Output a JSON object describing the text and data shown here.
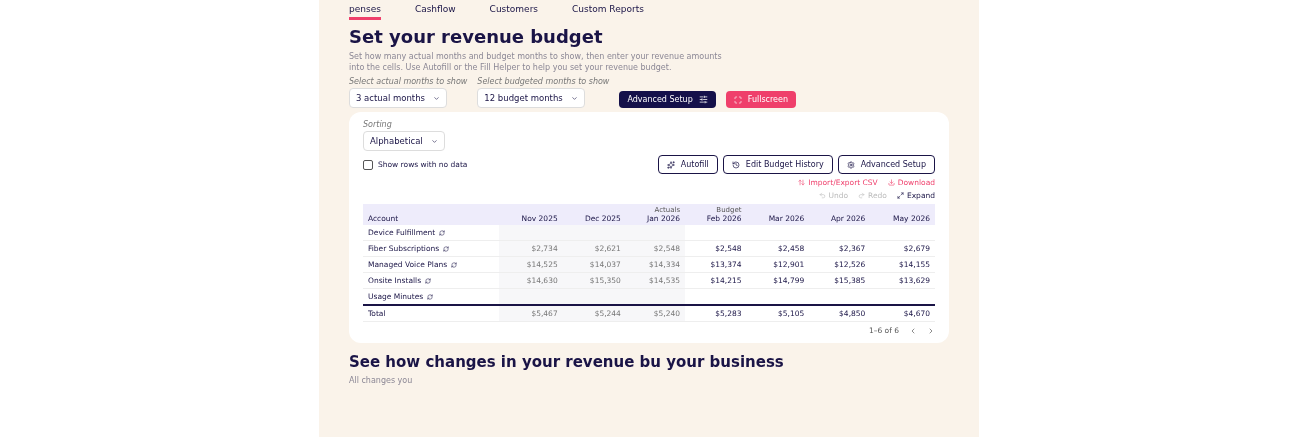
{
  "nav_tabs": [
    {
      "label": "penses",
      "selected": true
    },
    {
      "label": "Cashflow",
      "selected": false
    },
    {
      "label": "Customers",
      "selected": false
    },
    {
      "label": "Custom Reports",
      "selected": false
    }
  ],
  "title": "Set your revenue budget",
  "description": "Set how many actual months and budget months to show, then enter your revenue amounts into the cells. Use Autofill or the Fill Helper to help you set your revenue budget.",
  "selects": [
    {
      "label": "Select actual months to show",
      "value": "3 actual months"
    },
    {
      "label": "Select budgeted months to show",
      "value": "12 budget months"
    }
  ],
  "advanced_setup_button": "Advanced Setup",
  "fullscreen_button": "Fullscreen",
  "sorting": {
    "label": "Sorting",
    "value": "Alphabetical"
  },
  "show_empty_rows": {
    "label": "Show rows with no data",
    "checked": false
  },
  "actions": [
    "Autofill",
    "Edit Budget History",
    "Advanced Setup"
  ],
  "import_export": "Import/Export CSV",
  "download": "Download",
  "undo": "Undo",
  "redo": "Redo",
  "expand": "Expand",
  "table": {
    "account_header": "Account",
    "actuals_label": "Actuals",
    "budget_label": "Budget",
    "actual_columns": [
      "Nov 2025",
      "Dec 2025",
      "Jan 2026"
    ],
    "budget_columns": [
      "Feb 2026",
      "Mar 2026",
      "Apr 2026",
      "May 2026"
    ],
    "rows": [
      {
        "account": "Device Fulfillment"
      },
      {
        "account": "Fiber Subscriptions",
        "actuals": [
          "$2,734",
          "$2,621",
          "$2,548"
        ],
        "budget": [
          "$2,548",
          "$2,458",
          "$2,367",
          "$2,679"
        ]
      },
      {
        "account": "Managed Voice Plans",
        "actuals": [
          "$14,525",
          "$14,037",
          "$14,334"
        ],
        "budget": [
          "$13,374",
          "$12,901",
          "$12,526",
          "$14,155"
        ]
      },
      {
        "account": "Onsite Installs",
        "actuals": [
          "$14,630",
          "$15,350",
          "$14,535"
        ],
        "budget": [
          "$14,215",
          "$14,799",
          "$15,385",
          "$13,629"
        ]
      },
      {
        "account": "Usage Minutes"
      }
    ],
    "total": {
      "account": "Total",
      "actuals": [
        "$5,467",
        "$5,244",
        "$5,240"
      ],
      "budget": [
        "$5,283",
        "$5,105",
        "$4,850",
        "$4,670"
      ]
    }
  },
  "pagination": "1–6 of 6",
  "section_title": "See how changes in your revenue bu your business",
  "section_text": "All changes you"
}
